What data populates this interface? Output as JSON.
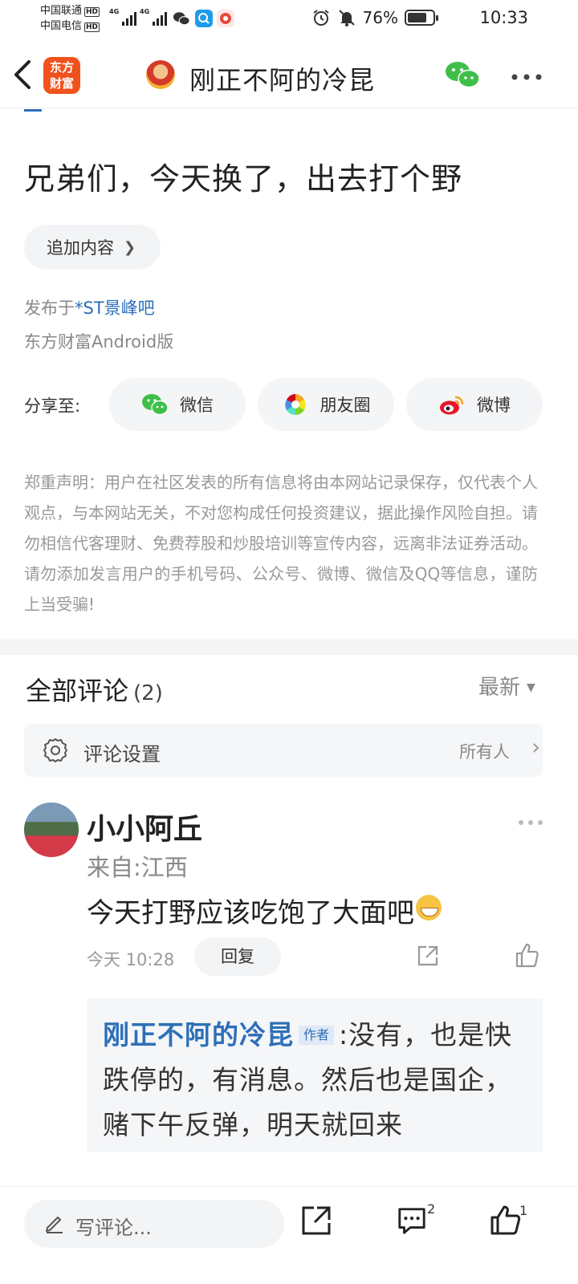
{
  "status_bar": {
    "carrier_1": "中国联通",
    "carrier_2": "中国电信",
    "hd": "HD",
    "network": "4G",
    "battery": "76%",
    "battery_level": 0.76,
    "time": "10:33"
  },
  "header": {
    "app_logo_line1": "东方",
    "app_logo_line2": "财富",
    "title": "刚正不阿的冷昆"
  },
  "post": {
    "title": "兄弟们，今天换了，出去打个野",
    "add_content": "追加内容",
    "published_prefix": "发布于",
    "published_bar": "*ST景峰吧",
    "client": "东方财富Android版"
  },
  "share": {
    "label": "分享至:",
    "wechat": "微信",
    "moments": "朋友圈",
    "weibo": "微博"
  },
  "disclaimer": "郑重声明：用户在社区发表的所有信息将由本网站记录保存，仅代表个人观点，与本网站无关，不对您构成任何投资建议，据此操作风险自担。请勿相信代客理财、免费荐股和炒股培训等宣传内容，远离非法证券活动。请勿添加发言用户的手机号码、公众号、微博、微信及QQ等信息，谨防上当受骗!",
  "comments": {
    "title": "全部评论",
    "count": "(2)",
    "sort": "最新",
    "settings_label": "评论设置",
    "settings_value": "所有人",
    "items": [
      {
        "name": "小小阿丘",
        "location": "来自:江西",
        "text": "今天打野应该吃饱了大面吧",
        "time": "今天 10:28",
        "reply_label": "回复",
        "reply": {
          "author": "刚正不阿的冷昆",
          "tag": "作者",
          "text": ":没有，也是快跌停的，有消息。然后也是国企，赌下午反弹，明天就回来"
        }
      }
    ]
  },
  "bottom_bar": {
    "write_placeholder": "写评论...",
    "comment_count": "2",
    "like_count": "1"
  },
  "colors": {
    "link_blue": "#2d6fb8",
    "brand_orange": "#f0521c",
    "wechat_green": "#3fbf4a",
    "weibo_red": "#e6162d"
  }
}
